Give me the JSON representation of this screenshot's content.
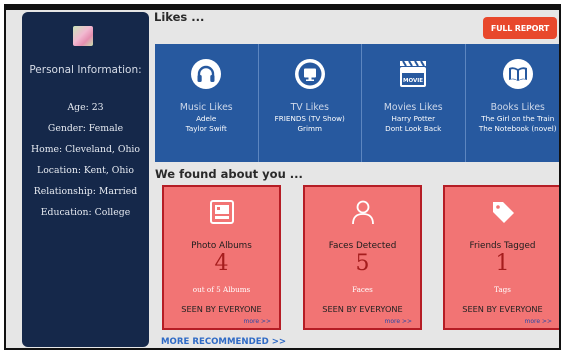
{
  "profile": {
    "section_title": "Personal Information:",
    "age": "Age: 23",
    "gender": "Gender: Female",
    "home": "Home: Cleveland, Ohio",
    "location": "Location: Kent, Ohio",
    "relationship": "Relationship: Married",
    "education": "Education: College"
  },
  "likes": {
    "heading": "Likes ...",
    "full_report_label": "FULL REPORT",
    "categories": [
      {
        "title": "Music Likes",
        "icon": "headphones-icon",
        "items": [
          "Adele",
          "Taylor Swift"
        ]
      },
      {
        "title": "TV Likes",
        "icon": "tv-icon",
        "items": [
          "FRIENDS (TV Show)",
          "Grimm"
        ]
      },
      {
        "title": "Movies Likes",
        "icon": "clapperboard-icon",
        "icon_text": "MOVIE",
        "items": [
          "Harry Potter",
          "Dont Look Back"
        ]
      },
      {
        "title": "Books Likes",
        "icon": "book-icon",
        "items": [
          "The Girl on the Train",
          "The Notebook (novel)"
        ]
      }
    ]
  },
  "found": {
    "heading": "We found about you ...",
    "cards": [
      {
        "title": "Photo Albums",
        "value": "4",
        "sub": "out of 5  Albums",
        "seen": "SEEN BY EVERYONE",
        "more": "more >>",
        "icon": "photo-album-icon"
      },
      {
        "title": "Faces Detected",
        "value": "5",
        "sub": "Faces",
        "seen": "SEEN BY EVERYONE",
        "more": "more >>",
        "icon": "person-icon"
      },
      {
        "title": "Friends Tagged",
        "value": "1",
        "sub": "Tags",
        "seen": "SEEN BY EVERYONE",
        "more": "more >>",
        "icon": "tag-icon"
      }
    ],
    "more_recommended": "MORE RECOMMENDED >>"
  },
  "colors": {
    "sidebar_bg": "#15284a",
    "likes_panel_bg": "#27599f",
    "card_bg": "#f27474",
    "card_border": "#b51d25",
    "accent_button": "#e8482c",
    "link_blue": "#2f6ac5"
  }
}
